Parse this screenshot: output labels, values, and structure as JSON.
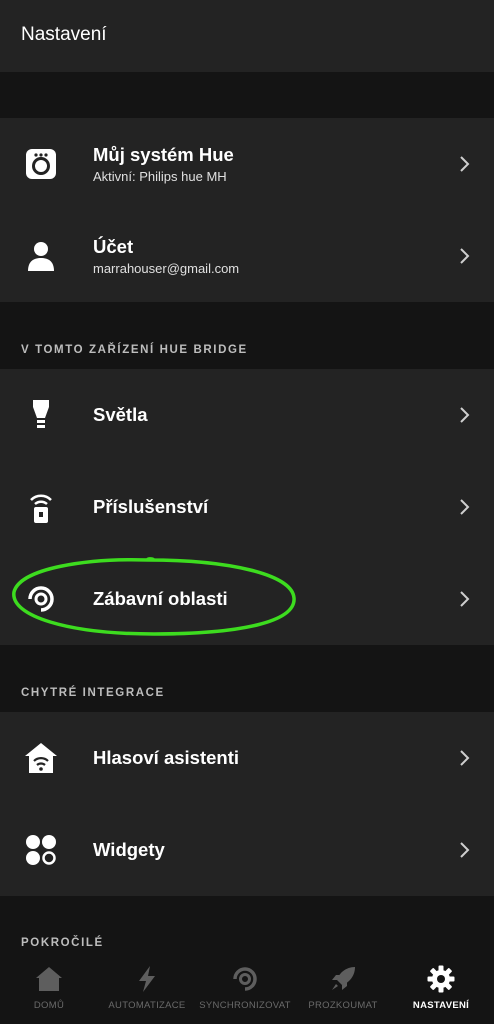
{
  "header": {
    "title": "Nastavení"
  },
  "account_group": [
    {
      "label": "Můj systém Hue",
      "sub": "Aktivní: Philips hue MH",
      "icon": "bridge-icon"
    },
    {
      "label": "Účet",
      "sub": "marrahouser@gmail.com",
      "icon": "person-icon"
    }
  ],
  "sections": {
    "bridge": "V TOMTO ZAŘÍZENÍ HUE BRIDGE",
    "integrations": "CHYTRÉ INTEGRACE",
    "advanced": "POKROČILÉ"
  },
  "bridge_group": [
    {
      "label": "Světla",
      "icon": "bulb-icon"
    },
    {
      "label": "Příslušenství",
      "icon": "remote-sensor-icon"
    },
    {
      "label": "Zábavní oblasti",
      "icon": "entertainment-area-icon"
    }
  ],
  "integrations_group": [
    {
      "label": "Hlasoví asistenti",
      "icon": "voice-home-icon"
    },
    {
      "label": "Widgety",
      "icon": "widgets-icon"
    }
  ],
  "bottom_nav": [
    {
      "label": "DOMŮ",
      "icon": "home-icon",
      "active": false
    },
    {
      "label": "AUTOMATIZACE",
      "icon": "lightning-icon",
      "active": false
    },
    {
      "label": "SYNCHRONIZOVAT",
      "icon": "sync-icon",
      "active": false
    },
    {
      "label": "PROZKOUMAT",
      "icon": "rocket-icon",
      "active": false
    },
    {
      "label": "NASTAVENÍ",
      "icon": "gear-icon",
      "active": true
    }
  ],
  "colors": {
    "background": "#141414",
    "surface": "#232323",
    "highlight_annotation": "#3ddc1f",
    "inactive_nav": "#6a6a6a"
  }
}
